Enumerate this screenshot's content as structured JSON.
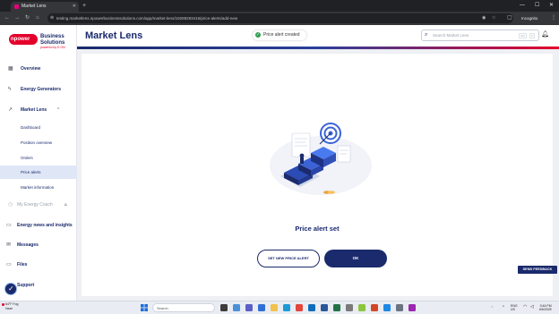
{
  "browser": {
    "tab_title": "Market Lens",
    "url": "testing.marketlens.npowerbusinesssolutions.com/app/market-lens/19289293415/price-alerts/add-new",
    "incognito_label": "Incognito"
  },
  "brand": {
    "logo_text": "npower",
    "name": "Business Solutions",
    "tagline": "powered by E.ON",
    "primary_color": "#1a2a6c",
    "accent_color": "#e4002b"
  },
  "sidebar": {
    "items": [
      {
        "label": "Overview",
        "icon": "grid-icon"
      },
      {
        "label": "Energy Generators",
        "icon": "bolt-icon"
      },
      {
        "label": "Market Lens",
        "icon": "trend-icon"
      },
      {
        "label": "My Energy Coach",
        "icon": "coach-icon"
      },
      {
        "label": "Energy news and insights",
        "icon": "news-icon"
      },
      {
        "label": "Messages",
        "icon": "mail-icon"
      },
      {
        "label": "Files",
        "icon": "folder-icon"
      },
      {
        "label": "Support",
        "icon": "support-icon"
      }
    ],
    "sub_items": [
      "Dashboard",
      "Position overview",
      "Orders",
      "Price alerts",
      "Market information"
    ],
    "active_sub": "Price alerts"
  },
  "header": {
    "title": "Market Lens",
    "toast": "Price alert created",
    "search_placeholder": "Search Market Lens",
    "kbd_ctrl": "Ctrl",
    "kbd_k": "K"
  },
  "result": {
    "title": "Price alert set",
    "secondary_button": "SET NEW PRICE ALERT",
    "primary_button": "OK"
  },
  "feedback_button": "SEND FEEDBACK",
  "taskbar": {
    "weather_temp": "64°F",
    "weather_desc": "Fog",
    "weather_note": "Haze",
    "search_label": "Search",
    "lang": "ENG",
    "region": "US",
    "time": "3:46 PM",
    "date": "6/6/2025"
  }
}
